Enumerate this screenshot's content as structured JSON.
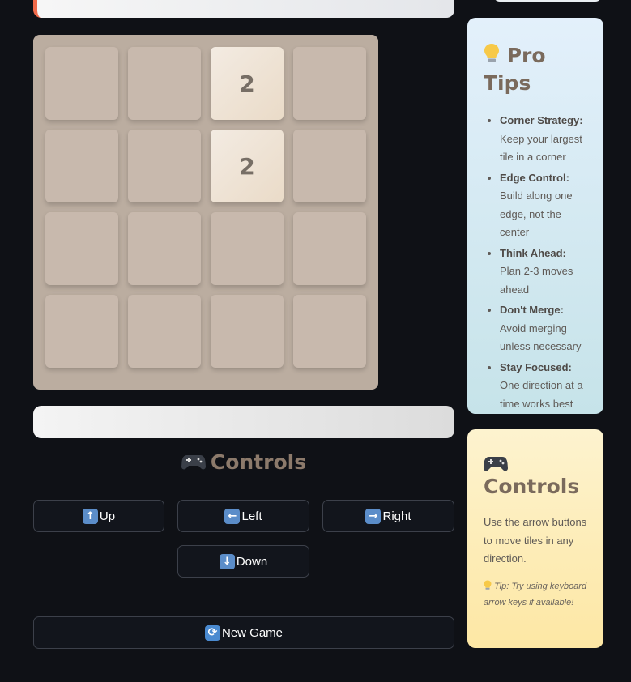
{
  "board": {
    "size": 4,
    "cells": [
      [
        null,
        null,
        2,
        null
      ],
      [
        null,
        null,
        2,
        null
      ],
      [
        null,
        null,
        null,
        null
      ],
      [
        null,
        null,
        null,
        null
      ]
    ]
  },
  "main": {
    "controls_heading": "Controls"
  },
  "buttons": {
    "up": "Up",
    "left": "Left",
    "right": "Right",
    "down": "Down",
    "new_game": "New Game"
  },
  "icons": {
    "up": "up-arrow-icon",
    "left": "left-arrow-icon",
    "right": "right-arrow-icon",
    "down": "down-arrow-icon",
    "new_game": "refresh-icon",
    "heading": "gamepad-icon",
    "tips": "lightbulb-icon"
  },
  "sidebar": {
    "tips": {
      "title": "Pro Tips",
      "items": [
        {
          "label": "Corner Strategy:",
          "text": "Keep your largest tile in a corner"
        },
        {
          "label": "Edge Control:",
          "text": "Build along one edge, not the center"
        },
        {
          "label": "Think Ahead:",
          "text": "Plan 2-3 moves ahead"
        },
        {
          "label": "Don't Merge:",
          "text": "Avoid merging unless necessary"
        },
        {
          "label": "Stay Focused:",
          "text": "One direction at a time works best"
        }
      ]
    },
    "controls": {
      "title": "Controls",
      "description": "Use the arrow buttons to move tiles in any direction.",
      "tip": "Tip: Try using keyboard arrow keys if available!"
    }
  },
  "colors": {
    "background": "#0f1116",
    "board": "#bbada0",
    "empty_tile": "#c8b9ad",
    "tile_2": "#eee4da",
    "heading": "#8c7a6b",
    "accent": "#f06a4a"
  }
}
